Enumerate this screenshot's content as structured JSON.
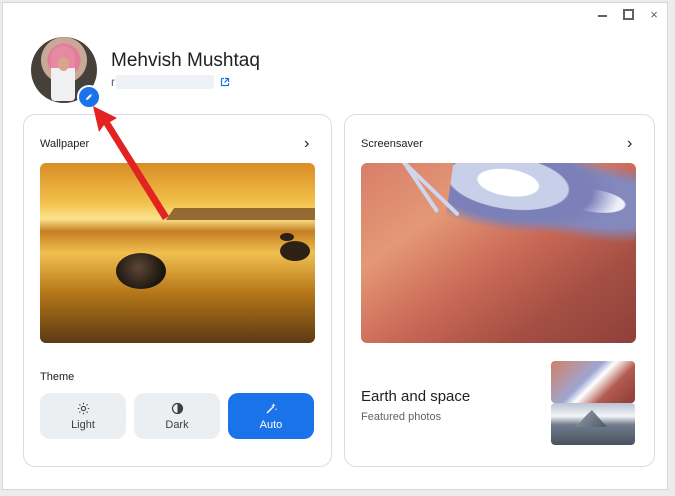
{
  "window": {
    "controls": {
      "minimize_icon": "minimize-icon",
      "maximize_icon": "maximize-icon",
      "close_icon": "×"
    }
  },
  "profile": {
    "name": "Mehvish Mushtaq",
    "email_start": "r",
    "edit_icon": "pencil-icon",
    "external_icon": "open-in-new-icon"
  },
  "wallpaper": {
    "title": "Wallpaper",
    "chevron": "›",
    "theme_label": "Theme",
    "buttons": [
      {
        "label": "Light",
        "icon": "light-mode-icon",
        "active": false
      },
      {
        "label": "Dark",
        "icon": "dark-mode-icon",
        "active": false
      },
      {
        "label": "Auto",
        "icon": "auto-mode-icon",
        "active": true
      }
    ]
  },
  "screensaver": {
    "title": "Screensaver",
    "chevron": "›",
    "collection_title": "Earth and space",
    "collection_subtitle": "Featured photos"
  },
  "colors": {
    "accent": "#1a73e8",
    "annotation_arrow": "#e32222"
  }
}
